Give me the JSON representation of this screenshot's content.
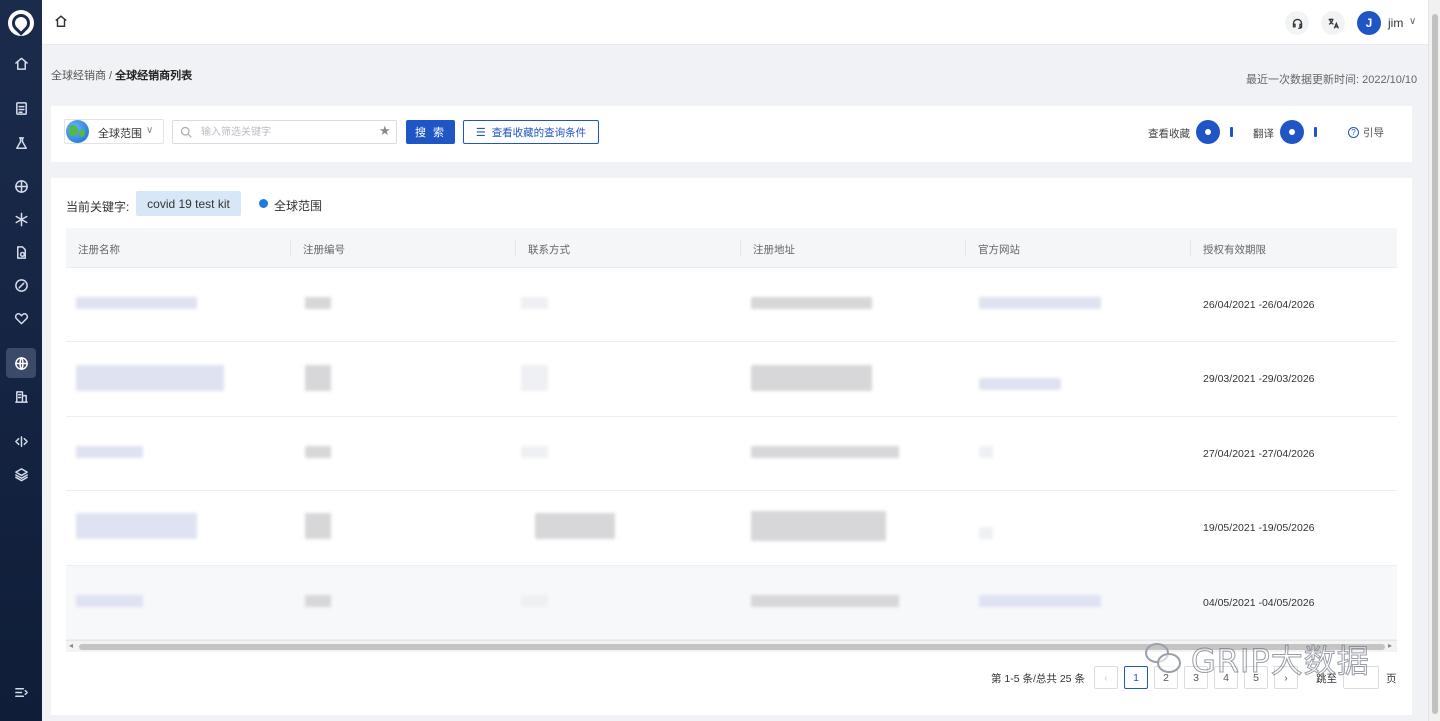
{
  "header": {
    "user_initial": "J",
    "user_name": "jim"
  },
  "breadcrumb": {
    "parent": "全球经销商",
    "separator": " / ",
    "current": "全球经销商列表"
  },
  "update_time": "最近一次数据更新时间: 2022/10/10",
  "filter": {
    "scope_label": "全球范围",
    "search_placeholder": "输入筛选关键字",
    "search_value": "",
    "search_button": "搜 索",
    "saved_queries_button": "查看收藏的查询条件",
    "view_favorites_label": "查看收藏",
    "view_favorites_on": true,
    "translate_label": "翻译",
    "translate_on": true,
    "guide_label": "引导"
  },
  "results": {
    "keyword_label": "当前关键字:",
    "keyword": "covid 19 test kit",
    "scope": "全球范围",
    "columns": [
      "注册名称",
      "注册编号",
      "联系方式",
      "注册地址",
      "官方网站",
      "授权有效期限"
    ],
    "rows": [
      {
        "validity": "26/04/2021 -26/04/2026"
      },
      {
        "validity": "29/03/2021 -29/03/2026"
      },
      {
        "validity": "27/04/2021 -27/04/2026"
      },
      {
        "validity": "19/05/2021 -19/05/2026"
      },
      {
        "validity": "04/05/2021 -04/05/2026"
      }
    ]
  },
  "pagination": {
    "summary": "第 1-5 条/总共 25 条",
    "pages": [
      "1",
      "2",
      "3",
      "4",
      "5"
    ],
    "current_page": "1",
    "jump_label": "跳至",
    "page_suffix": "页"
  },
  "watermark": "GRIP大数据",
  "colors": {
    "sidebar": "#1b2b4c",
    "primary": "#1f55c4",
    "keyword_chip": "#d8e7f7"
  }
}
